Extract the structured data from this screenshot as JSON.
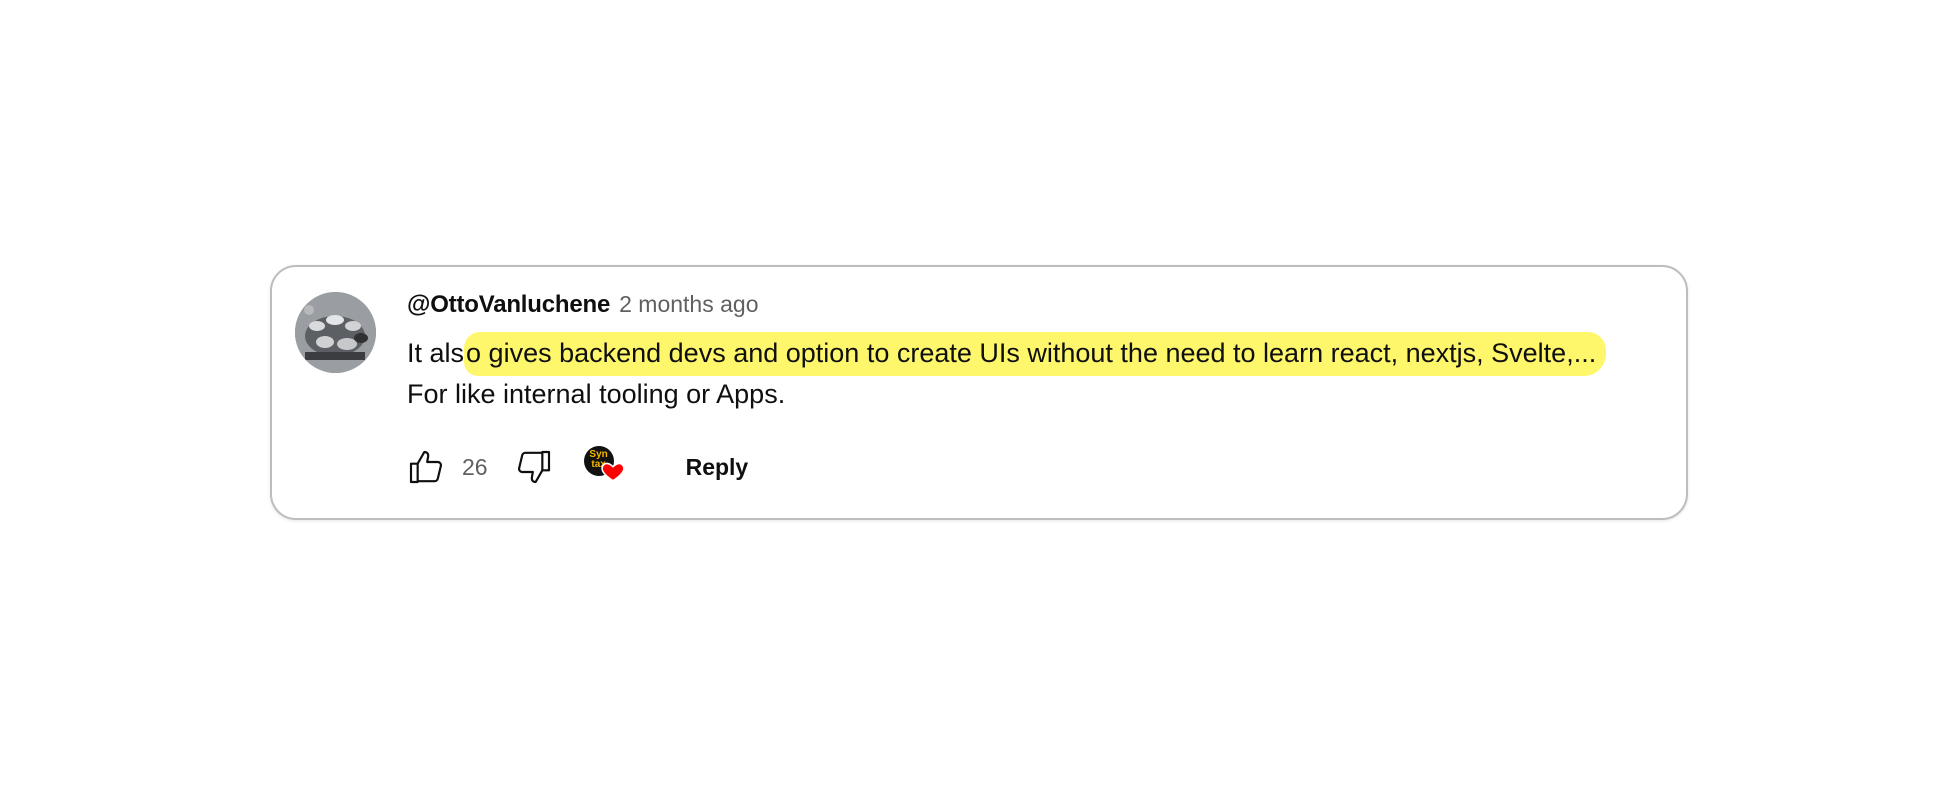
{
  "comment": {
    "author": "@OttoVanluchene",
    "time": "2 months ago",
    "text_line1": "It also gives backend devs and option to create UIs without the need to learn react, nextjs, Svelte,...",
    "text_line2": "For like internal tooling or Apps."
  },
  "actions": {
    "like_count": "26",
    "reply_label": "Reply",
    "creator_avatar_text": "Syntax",
    "like_icon": "thumbs-up-icon",
    "dislike_icon": "thumbs-down-icon",
    "heart_icon": "heart-icon"
  },
  "colors": {
    "highlight": "#fef76b",
    "heart": "#ff0000",
    "secondary_text": "#606060"
  }
}
